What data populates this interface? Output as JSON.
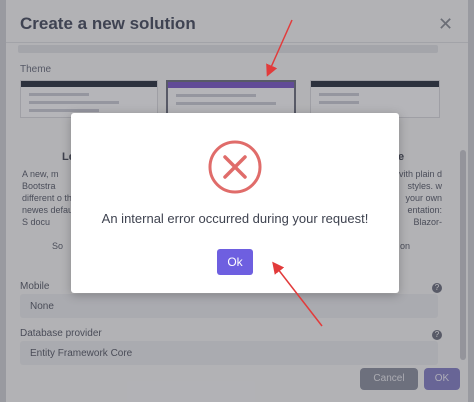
{
  "background_dialog": {
    "title": "Create a new solution",
    "theme_label": "Theme",
    "cards": {
      "left_heading": "Le",
      "left_text": "A new, m Bootstra different o the newes default, S docu",
      "left_link": "So",
      "right_heading": "e",
      "right_text": "vith plain d styles. w your own entation: Blazor-",
      "right_link": "on"
    },
    "mobile_label": "Mobile",
    "mobile_value": "None",
    "db_provider_label": "Database provider",
    "db_provider_value": "Entity Framework Core",
    "cancel_label": "Cancel",
    "ok_label": "OK"
  },
  "alert": {
    "message": "An internal error occurred during your request!",
    "ok_label": "Ok",
    "icon": "error-x-circle-icon",
    "icon_color": "#e06c6a",
    "button_color": "#6e5fe0"
  },
  "annotation_color": "#e23b3b"
}
